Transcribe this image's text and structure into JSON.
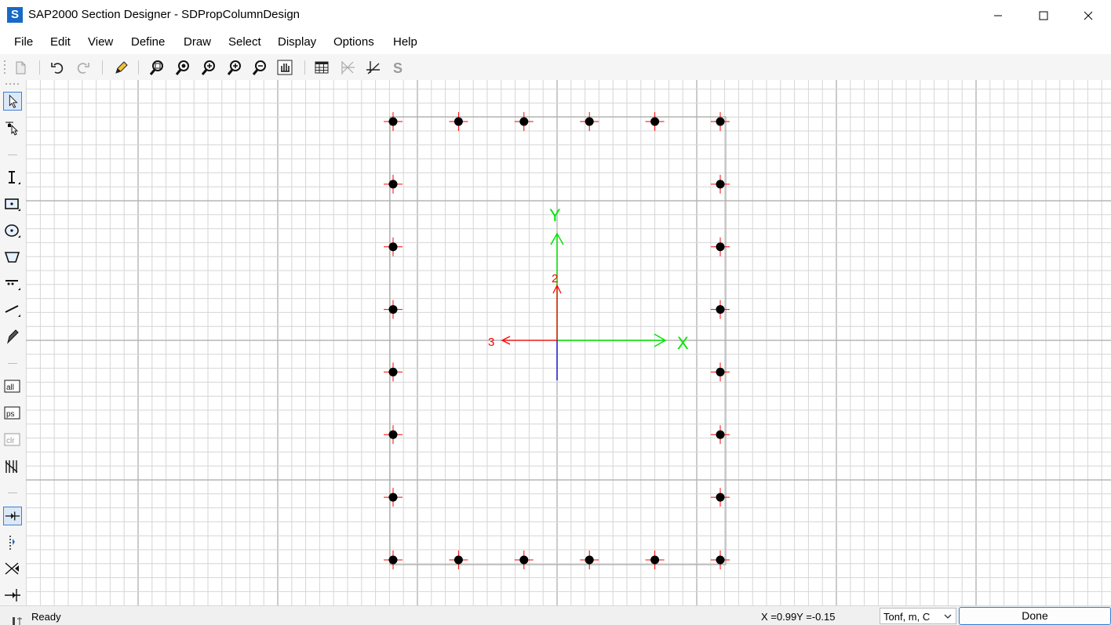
{
  "window": {
    "title": "SAP2000 Section Designer - SDPropColumnDesign",
    "app_icon_letter": "S"
  },
  "menu": [
    "File",
    "Edit",
    "View",
    "Define",
    "Draw",
    "Select",
    "Display",
    "Options",
    "Help"
  ],
  "toolbar_icons": [
    "new-icon",
    "undo-icon",
    "redo-icon",
    "pencil-icon",
    "zoom-window-icon",
    "zoom-restore-icon",
    "zoom-in-icon",
    "zoom-out-icon",
    "zoom-pan-icon",
    "pan-hand-icon",
    "table-icon",
    "graph-icon",
    "axes-icon",
    "s-icon"
  ],
  "left_toolbar_icons": [
    "pointer-icon",
    "reshaper-icon",
    "draw-i-section-icon",
    "draw-rect-icon",
    "draw-circle-icon",
    "draw-polygon-icon",
    "draw-rebar-line-icon",
    "draw-rebar-icon",
    "snap-pencil-icon",
    "select-all-icon",
    "previous-selection-icon",
    "clear-selection-icon",
    "select-grid-icon",
    "snap-intersection-icon",
    "snap-midpoint-icon",
    "snap-cross-icon",
    "snap-end-icon"
  ],
  "canvas": {
    "axis_labels": {
      "y_global": "Y",
      "x_global": "X",
      "local_2": "2",
      "local_3": "3"
    },
    "colors": {
      "global_axes": "#00e400",
      "local_axes": "#ff0000",
      "local_axis_1": "#0000cc",
      "rebar_fill": "#000000",
      "rebar_cross": "#ff0000",
      "grid": "#d6d6d6",
      "grid_major": "#b5b5b5",
      "section_outline": "#a8a8a8"
    },
    "rebar_layout": {
      "columns": 6,
      "rows": 8,
      "total_bars": 24
    }
  },
  "status": {
    "text": "Ready",
    "coords": "X =0.99Y =-0.15",
    "units": "Tonf, m, C",
    "done_button": "Done"
  }
}
